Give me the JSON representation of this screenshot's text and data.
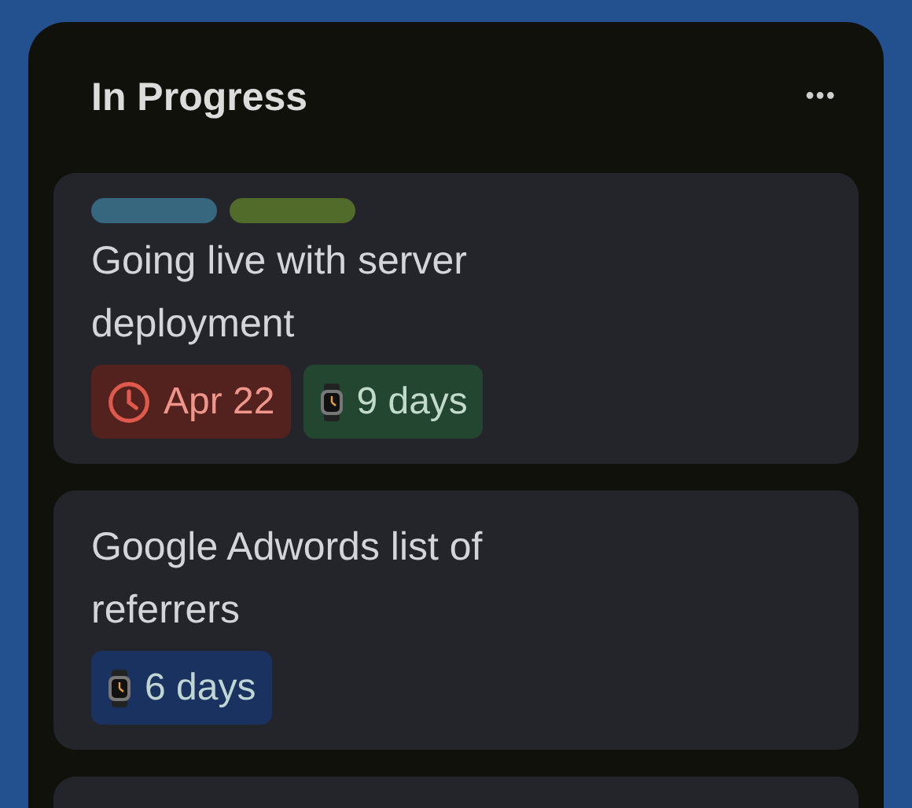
{
  "column": {
    "title": "In Progress",
    "menu": "•••"
  },
  "cards": [
    {
      "labels": [
        {
          "color": "#36677f"
        },
        {
          "color": "#516b2a"
        }
      ],
      "title": "Going live with server deployment",
      "badges": [
        {
          "kind": "due",
          "text": "Apr 22",
          "color": "#53221e"
        },
        {
          "kind": "timer",
          "text": "9 days",
          "color": "#234631"
        }
      ]
    },
    {
      "title": "Google Adwords list of referrers",
      "badges": [
        {
          "kind": "timer",
          "text": "6 days",
          "color": "#1a325f"
        }
      ]
    },
    {
      "cut_off": true
    }
  ]
}
